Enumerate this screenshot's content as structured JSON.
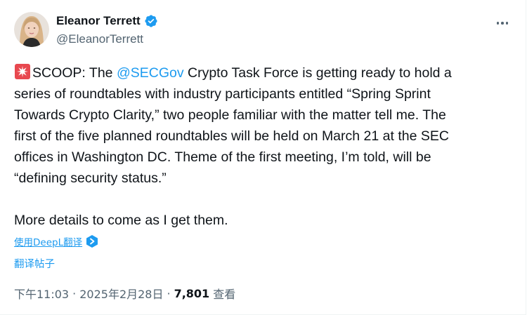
{
  "author": {
    "display_name": "Eleanor Terrett",
    "handle": "@EleanorTerrett",
    "verified": true,
    "avatar_icon": "avatar-photo"
  },
  "tweet": {
    "prefix": "SCOOP: The ",
    "mention": "@SECGov",
    "line1_rest": " Crypto Task Force is getting ready to hold a",
    "line2": "series of roundtables with industry participants entitled “Spring Sprint",
    "line3": "Towards Crypto Clarity,” two people familiar with the matter tell me. The",
    "line4": "first of the five planned roundtables will be held on March 21 at the SEC",
    "line5": "offices in Washington DC. Theme of the first meeting, I’m told, will be",
    "line6": "“defining security status.”",
    "line7": "More details to come as I get them.",
    "emoji_icon": "siren-icon"
  },
  "translate": {
    "deepl_label": "使用DeepL翻译",
    "post_label": "翻译帖子"
  },
  "meta": {
    "time": "下午11:03",
    "separator1": "·",
    "date": "2025年2月28日",
    "separator2": "·",
    "views_count": "7,801",
    "views_label": "查看"
  },
  "colors": {
    "accent": "#1d9bf0",
    "text": "#0f1419",
    "secondary": "#536471"
  }
}
